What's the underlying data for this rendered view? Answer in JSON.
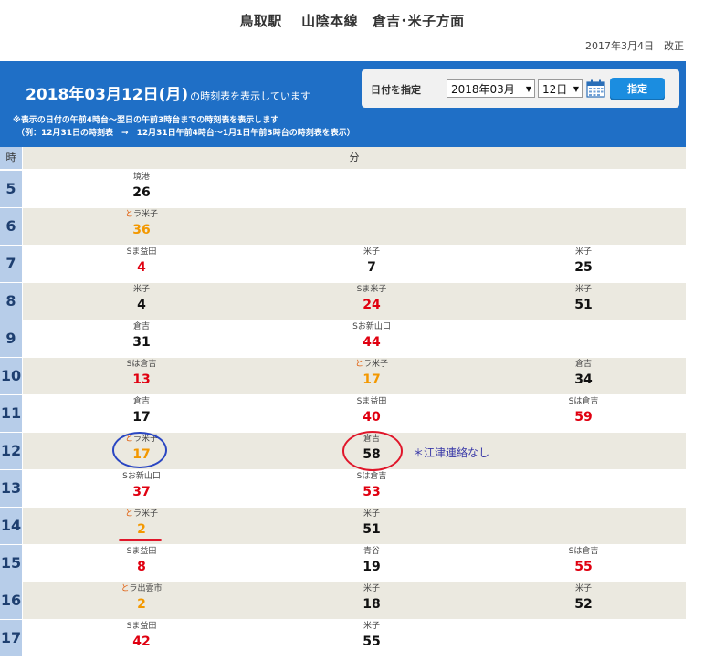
{
  "header": {
    "title": "鳥取駅　 山陰本線　倉吉･米子方面",
    "revised": "2017年3月4日　改正"
  },
  "banner": {
    "date": "2018年03月12日(月)",
    "suffix": "の時刻表を表示しています",
    "note1": "※表示の日付の午前4時台～翌日の午前3時台までの時刻表を表示します",
    "note2": "（例：12月31日の時刻表　→　12月31日午前4時台～1月1日午前3時台の時刻表を表示）",
    "date_picker": {
      "label": "日付を指定",
      "month_value": "2018年03月",
      "day_value": "12日",
      "submit_label": "指定",
      "calendar_icon": "calendar-icon"
    }
  },
  "table": {
    "hour_header": "時",
    "minute_header": "分",
    "rows": [
      {
        "hour": "5",
        "trains": [
          {
            "mark": "",
            "dest": "境港",
            "min": "26",
            "color": "black"
          }
        ]
      },
      {
        "hour": "6",
        "trains": [
          {
            "mark": "と",
            "dest": "ラ米子",
            "min": "36",
            "color": "orange"
          }
        ]
      },
      {
        "hour": "7",
        "trains": [
          {
            "mark": "",
            "dest": "Sま益田",
            "min": "4",
            "color": "red"
          },
          {
            "mark": "",
            "dest": "米子",
            "min": "7",
            "color": "black"
          },
          {
            "mark": "",
            "dest": "米子",
            "min": "25",
            "color": "black"
          }
        ]
      },
      {
        "hour": "8",
        "trains": [
          {
            "mark": "",
            "dest": "米子",
            "min": "4",
            "color": "black"
          },
          {
            "mark": "",
            "dest": "Sま米子",
            "min": "24",
            "color": "red"
          },
          {
            "mark": "",
            "dest": "米子",
            "min": "51",
            "color": "black"
          }
        ]
      },
      {
        "hour": "9",
        "trains": [
          {
            "mark": "",
            "dest": "倉吉",
            "min": "31",
            "color": "black"
          },
          {
            "mark": "",
            "dest": "Sお新山口",
            "min": "44",
            "color": "red"
          }
        ]
      },
      {
        "hour": "10",
        "trains": [
          {
            "mark": "",
            "dest": "Sは倉吉",
            "min": "13",
            "color": "red"
          },
          {
            "mark": "と",
            "dest": "ラ米子",
            "min": "17",
            "color": "orange"
          },
          {
            "mark": "",
            "dest": "倉吉",
            "min": "34",
            "color": "black"
          }
        ]
      },
      {
        "hour": "11",
        "trains": [
          {
            "mark": "",
            "dest": "倉吉",
            "min": "17",
            "color": "black"
          },
          {
            "mark": "",
            "dest": "Sま益田",
            "min": "40",
            "color": "red"
          },
          {
            "mark": "",
            "dest": "Sは倉吉",
            "min": "59",
            "color": "red"
          }
        ]
      },
      {
        "hour": "12",
        "trains": [
          {
            "mark": "と",
            "dest": "ラ米子",
            "min": "17",
            "color": "orange"
          },
          {
            "mark": "",
            "dest": "倉吉",
            "min": "58",
            "color": "black"
          }
        ]
      },
      {
        "hour": "13",
        "trains": [
          {
            "mark": "",
            "dest": "Sお新山口",
            "min": "37",
            "color": "red"
          },
          {
            "mark": "",
            "dest": "Sは倉吉",
            "min": "53",
            "color": "red"
          }
        ]
      },
      {
        "hour": "14",
        "trains": [
          {
            "mark": "と",
            "dest": "ラ米子",
            "min": "2",
            "color": "orange"
          },
          {
            "mark": "",
            "dest": "米子",
            "min": "51",
            "color": "black"
          }
        ]
      },
      {
        "hour": "15",
        "trains": [
          {
            "mark": "",
            "dest": "Sま益田",
            "min": "8",
            "color": "red"
          },
          {
            "mark": "",
            "dest": "青谷",
            "min": "19",
            "color": "black"
          },
          {
            "mark": "",
            "dest": "Sは倉吉",
            "min": "55",
            "color": "red"
          }
        ]
      },
      {
        "hour": "16",
        "trains": [
          {
            "mark": "と",
            "dest": "ラ出雲市",
            "min": "2",
            "color": "orange"
          },
          {
            "mark": "",
            "dest": "米子",
            "min": "18",
            "color": "black"
          },
          {
            "mark": "",
            "dest": "米子",
            "min": "52",
            "color": "black"
          }
        ]
      },
      {
        "hour": "17",
        "trains": [
          {
            "mark": "",
            "dest": "Sま益田",
            "min": "42",
            "color": "red"
          },
          {
            "mark": "",
            "dest": "米子",
            "min": "55",
            "color": "black"
          }
        ]
      }
    ]
  },
  "annotation": {
    "text": "＊江津連絡なし",
    "colors": {
      "blue_circle": "#2a46c2",
      "red_circle": "#e0162a",
      "text": "#3a3aa8"
    }
  },
  "colors": {
    "banner": "#1f6fc6",
    "hour_cell": "#b7cde9",
    "shaded_row": "#ebe9e0",
    "minute_red": "#e00010",
    "minute_orange": "#f39800",
    "button": "#1b8de0"
  }
}
